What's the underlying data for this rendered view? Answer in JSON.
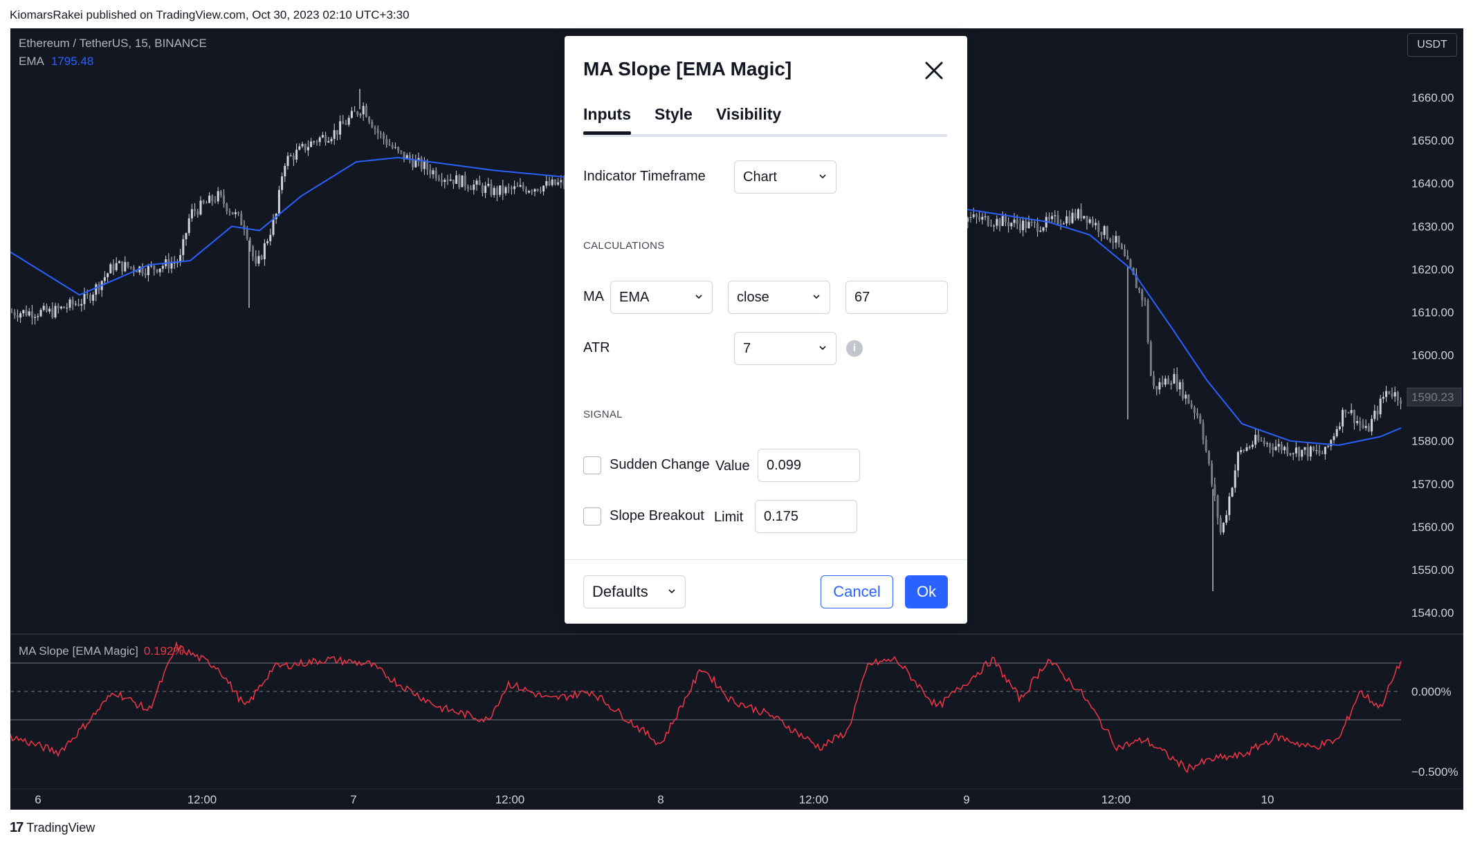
{
  "published_line": "KiomarsRakei published on TradingView.com, Oct 30, 2023 02:10 UTC+3:30",
  "chart": {
    "symbol": "Ethereum / TetherUS, 15, BINANCE",
    "ema_label": "EMA",
    "ema_value": "1795.48",
    "currency_button": "USDT",
    "price_ticks": [
      "1660.00",
      "1650.00",
      "1640.00",
      "1630.00",
      "1620.00",
      "1610.00",
      "1600.00",
      "1590.23",
      "1580.00",
      "1570.00",
      "1560.00",
      "1550.00",
      "1540.00"
    ],
    "current_price": "1590.23",
    "oscillator_label": "MA Slope [EMA Magic]",
    "oscillator_value": "0.192%",
    "osc_ticks": [
      "0.000%",
      "−0.500%"
    ],
    "time_ticks": [
      "6",
      "12:00",
      "7",
      "12:00",
      "8",
      "12:00",
      "9",
      "12:00",
      "10"
    ],
    "colors": {
      "background": "#131722",
      "ema": "#2962ff",
      "oscillator": "#f23645",
      "candle": "#d1d4dc"
    }
  },
  "dialog": {
    "title": "MA Slope [EMA Magic]",
    "tabs": [
      "Inputs",
      "Style",
      "Visibility"
    ],
    "active_tab": "Inputs",
    "indicator_timeframe_label": "Indicator Timeframe",
    "indicator_timeframe_value": "Chart",
    "section_calculations": "CALCULATIONS",
    "ma_label": "MA",
    "ma_type": "EMA",
    "ma_source": "close",
    "ma_length": "67",
    "atr_label": "ATR",
    "atr_value": "7",
    "section_signal": "SIGNAL",
    "sudden_change_label": "Sudden Change",
    "sudden_change_value_label": "Value",
    "sudden_change_value": "0.099",
    "slope_breakout_label": "Slope Breakout",
    "slope_breakout_limit_label": "Limit",
    "slope_breakout_limit": "0.175",
    "defaults_label": "Defaults",
    "cancel_label": "Cancel",
    "ok_label": "Ok"
  },
  "footer_brand": "TradingView"
}
